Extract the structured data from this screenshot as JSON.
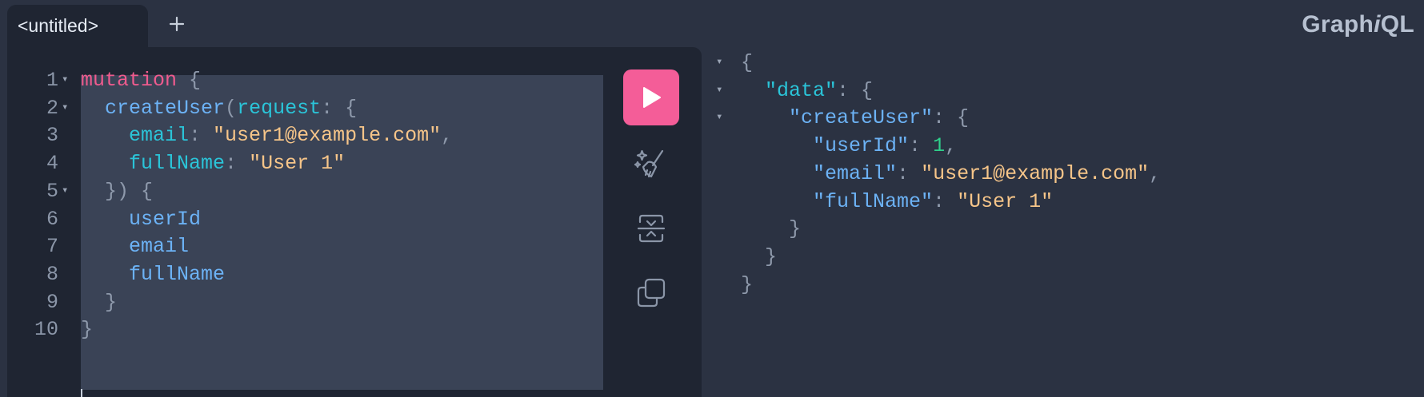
{
  "header": {
    "tab_label": "<untitled>",
    "add_tab_icon": "plus-icon",
    "logo_prefix": "Graph",
    "logo_italic": "i",
    "logo_suffix": "QL"
  },
  "toolbar": {
    "run_icon": "play-icon",
    "prettify_icon": "magic-wand-icon",
    "merge_icon": "merge-fragments-icon",
    "copy_icon": "copy-icon"
  },
  "editor": {
    "line_numbers": [
      "1",
      "2",
      "3",
      "4",
      "5",
      "6",
      "7",
      "8",
      "9",
      "10"
    ],
    "fold_markers": [
      "▾",
      "▾",
      "",
      "",
      "▾",
      "",
      "",
      "",
      "",
      ""
    ],
    "lines": [
      [
        {
          "t": "kw",
          "v": "mutation"
        },
        {
          "t": "plain",
          "v": " "
        },
        {
          "t": "punct",
          "v": "{"
        }
      ],
      [
        {
          "t": "plain",
          "v": "  "
        },
        {
          "t": "field",
          "v": "createUser"
        },
        {
          "t": "punct",
          "v": "("
        },
        {
          "t": "arg",
          "v": "request"
        },
        {
          "t": "punct",
          "v": ": {"
        }
      ],
      [
        {
          "t": "plain",
          "v": "    "
        },
        {
          "t": "arg",
          "v": "email"
        },
        {
          "t": "punct",
          "v": ": "
        },
        {
          "t": "str",
          "v": "\"user1@example.com\""
        },
        {
          "t": "punct",
          "v": ","
        }
      ],
      [
        {
          "t": "plain",
          "v": "    "
        },
        {
          "t": "arg",
          "v": "fullName"
        },
        {
          "t": "punct",
          "v": ": "
        },
        {
          "t": "str",
          "v": "\"User 1\""
        }
      ],
      [
        {
          "t": "plain",
          "v": "  "
        },
        {
          "t": "punct",
          "v": "}) {"
        }
      ],
      [
        {
          "t": "plain",
          "v": "    "
        },
        {
          "t": "field",
          "v": "userId"
        }
      ],
      [
        {
          "t": "plain",
          "v": "    "
        },
        {
          "t": "field",
          "v": "email"
        }
      ],
      [
        {
          "t": "plain",
          "v": "    "
        },
        {
          "t": "field",
          "v": "fullName"
        }
      ],
      [
        {
          "t": "plain",
          "v": "  "
        },
        {
          "t": "punct",
          "v": "}"
        }
      ],
      [
        {
          "t": "punct",
          "v": "}"
        }
      ]
    ]
  },
  "result": {
    "fold_markers": [
      "▾",
      "▾",
      "▾",
      "",
      "",
      "",
      "",
      "",
      ""
    ],
    "lines": [
      [
        {
          "t": "punct",
          "v": "{"
        }
      ],
      [
        {
          "t": "plain",
          "v": "  "
        },
        {
          "t": "key",
          "v": "\"data\""
        },
        {
          "t": "punct",
          "v": ": {"
        }
      ],
      [
        {
          "t": "plain",
          "v": "    "
        },
        {
          "t": "rkey",
          "v": "\"createUser\""
        },
        {
          "t": "punct",
          "v": ": {"
        }
      ],
      [
        {
          "t": "plain",
          "v": "      "
        },
        {
          "t": "rkey",
          "v": "\"userId\""
        },
        {
          "t": "punct",
          "v": ": "
        },
        {
          "t": "num",
          "v": "1"
        },
        {
          "t": "punct",
          "v": ","
        }
      ],
      [
        {
          "t": "plain",
          "v": "      "
        },
        {
          "t": "rkey",
          "v": "\"email\""
        },
        {
          "t": "punct",
          "v": ": "
        },
        {
          "t": "str",
          "v": "\"user1@example.com\""
        },
        {
          "t": "punct",
          "v": ","
        }
      ],
      [
        {
          "t": "plain",
          "v": "      "
        },
        {
          "t": "rkey",
          "v": "\"fullName\""
        },
        {
          "t": "punct",
          "v": ": "
        },
        {
          "t": "str",
          "v": "\"User 1\""
        }
      ],
      [
        {
          "t": "plain",
          "v": "    "
        },
        {
          "t": "punct",
          "v": "}"
        }
      ],
      [
        {
          "t": "plain",
          "v": "  "
        },
        {
          "t": "punct",
          "v": "}"
        }
      ],
      [
        {
          "t": "punct",
          "v": "}"
        }
      ]
    ]
  },
  "colors": {
    "background": "#2b3242",
    "panel": "#1f2532",
    "accent": "#f45d98",
    "keyword": "#ef5b8e",
    "field": "#6cb2f5",
    "argument": "#2bc4d8",
    "string": "#f6c589",
    "number": "#2fd08b"
  }
}
